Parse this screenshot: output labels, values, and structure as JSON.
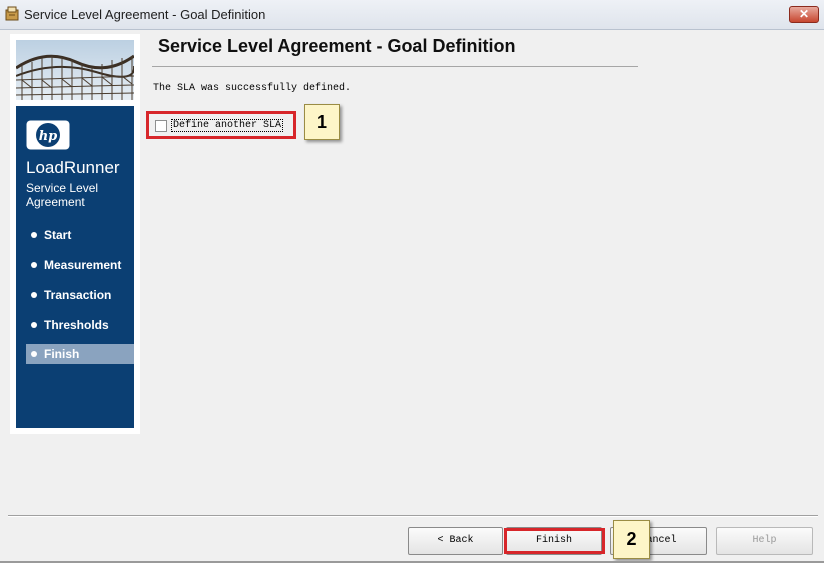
{
  "window": {
    "title": "Service Level Agreement - Goal Definition",
    "close_glyph": "✕"
  },
  "sidebar": {
    "product_name": "LoadRunner",
    "wizard_name": "Service Level Agreement",
    "steps": [
      {
        "label": "Start",
        "active": false
      },
      {
        "label": "Measurement",
        "active": false
      },
      {
        "label": "Transaction",
        "active": false
      },
      {
        "label": "Thresholds",
        "active": false
      },
      {
        "label": "Finish",
        "active": true
      }
    ]
  },
  "main": {
    "heading": "Service Level Agreement - Goal Definition",
    "message": "The SLA was successfully defined.",
    "define_another": {
      "label": "Define another SLA",
      "checked": false
    }
  },
  "buttons": {
    "back": "< Back",
    "finish": "Finish",
    "cancel": "Cancel",
    "help": "Help"
  },
  "annotations": {
    "callout_1": "1",
    "callout_2": "2"
  },
  "colors": {
    "sidebar_panel": "#0b3f73",
    "active_step": "#8aa3bf",
    "callout": "#d7262a"
  }
}
